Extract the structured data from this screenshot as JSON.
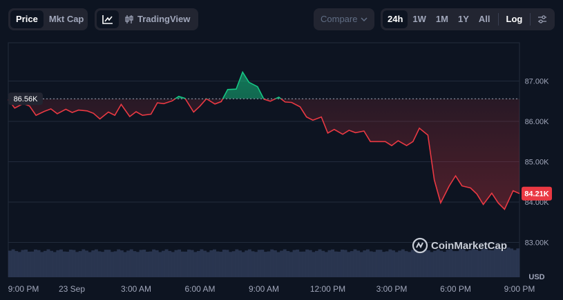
{
  "toolbar": {
    "type_tabs": [
      "Price",
      "Mkt Cap"
    ],
    "tradingview_label": "TradingView",
    "compare_label": "Compare",
    "ranges": [
      "24h",
      "1W",
      "1M",
      "1Y",
      "All"
    ],
    "log_label": "Log"
  },
  "colors": {
    "background": "#0d1421",
    "up": "#16c784",
    "down": "#ea3943",
    "volume": "#2f3b57",
    "grid": "#222b3c"
  },
  "icons": [
    "line-chart-icon",
    "candlestick-icon",
    "chevron-down-icon",
    "settings-sliders-icon",
    "coinmarketcap-logo-icon"
  ],
  "brand": "CoinMarketCap",
  "chart_data": {
    "type": "line",
    "currency_label": "USD",
    "reference_label": "86.56K",
    "reference_value": 86560,
    "last_label": "84.21K",
    "last_value": 84210,
    "y_ticks": [
      {
        "label": "87.00K",
        "value": 87000
      },
      {
        "label": "86.00K",
        "value": 86000
      },
      {
        "label": "85.00K",
        "value": 85000
      },
      {
        "label": "84.00K",
        "value": 84000
      },
      {
        "label": "83.00K",
        "value": 83000
      }
    ],
    "x_ticks": [
      "9:00 PM",
      "23 Sep",
      "3:00 AM",
      "6:00 AM",
      "9:00 AM",
      "12:00 PM",
      "3:00 PM",
      "6:00 PM",
      "9:00 PM"
    ],
    "x_range_hours": [
      0,
      24
    ],
    "series": [
      {
        "values": [
          [
            0.0,
            86540
          ],
          [
            0.3,
            86330
          ],
          [
            0.7,
            86440
          ],
          [
            1.0,
            86380
          ],
          [
            1.3,
            86150
          ],
          [
            1.7,
            86250
          ],
          [
            2.0,
            86310
          ],
          [
            2.3,
            86190
          ],
          [
            2.7,
            86300
          ],
          [
            3.0,
            86220
          ],
          [
            3.3,
            86280
          ],
          [
            3.7,
            86260
          ],
          [
            4.0,
            86200
          ],
          [
            4.3,
            86060
          ],
          [
            4.7,
            86230
          ],
          [
            5.0,
            86150
          ],
          [
            5.3,
            86420
          ],
          [
            5.7,
            86120
          ],
          [
            6.0,
            86240
          ],
          [
            6.3,
            86150
          ],
          [
            6.7,
            86180
          ],
          [
            7.0,
            86460
          ],
          [
            7.3,
            86440
          ],
          [
            7.7,
            86510
          ],
          [
            8.0,
            86620
          ],
          [
            8.3,
            86570
          ],
          [
            8.7,
            86230
          ],
          [
            9.0,
            86380
          ],
          [
            9.3,
            86560
          ],
          [
            9.7,
            86430
          ],
          [
            10.0,
            86490
          ],
          [
            10.3,
            86790
          ],
          [
            10.7,
            86800
          ],
          [
            11.0,
            87220
          ],
          [
            11.3,
            86970
          ],
          [
            11.7,
            86860
          ],
          [
            12.0,
            86550
          ],
          [
            12.3,
            86500
          ],
          [
            12.7,
            86600
          ],
          [
            13.0,
            86480
          ],
          [
            13.3,
            86470
          ],
          [
            13.7,
            86360
          ],
          [
            14.0,
            86110
          ],
          [
            14.3,
            86030
          ],
          [
            14.7,
            86110
          ],
          [
            15.0,
            85710
          ],
          [
            15.3,
            85800
          ],
          [
            15.7,
            85680
          ],
          [
            16.0,
            85780
          ],
          [
            16.3,
            85720
          ],
          [
            16.7,
            85760
          ],
          [
            17.0,
            85500
          ],
          [
            17.3,
            85500
          ],
          [
            17.7,
            85500
          ],
          [
            18.0,
            85400
          ],
          [
            18.3,
            85520
          ],
          [
            18.7,
            85400
          ],
          [
            19.0,
            85500
          ],
          [
            19.3,
            85830
          ],
          [
            19.7,
            85660
          ],
          [
            20.0,
            84550
          ],
          [
            20.3,
            83980
          ],
          [
            20.7,
            84400
          ],
          [
            21.0,
            84650
          ],
          [
            21.3,
            84400
          ],
          [
            21.7,
            84350
          ],
          [
            22.0,
            84200
          ],
          [
            22.3,
            83940
          ],
          [
            22.7,
            84220
          ],
          [
            23.0,
            83980
          ],
          [
            23.3,
            83820
          ],
          [
            23.7,
            84280
          ],
          [
            24.0,
            84210
          ]
        ]
      }
    ],
    "volume_level": 0.42
  }
}
